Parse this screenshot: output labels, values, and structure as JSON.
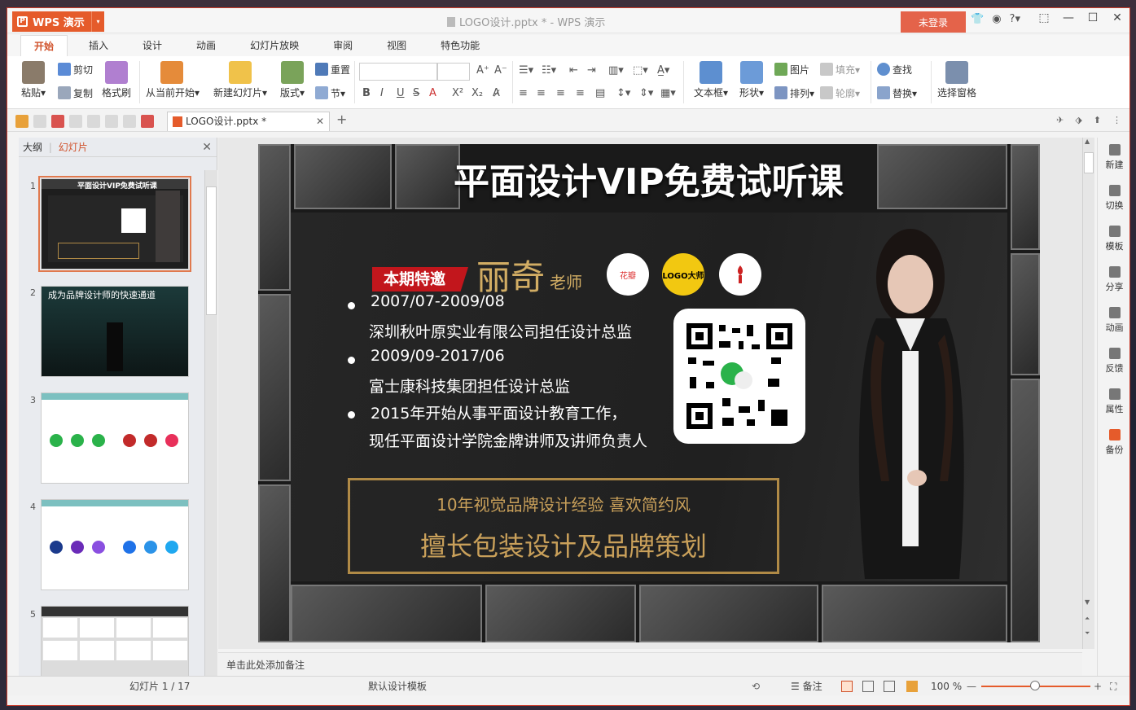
{
  "app": {
    "name": "WPS 演示",
    "window_title": "LOGO设计.pptx * - WPS 演示",
    "login": "未登录",
    "help": "?"
  },
  "tabs": [
    "开始",
    "插入",
    "设计",
    "动画",
    "幻灯片放映",
    "审阅",
    "视图",
    "特色功能"
  ],
  "ribbon": {
    "paste": "粘贴",
    "cut": "剪切",
    "copy": "复制",
    "format_painter": "格式刷",
    "from_current": "从当前开始",
    "new_slide": "新建幻灯片",
    "layout": "版式",
    "reset": "重置",
    "section": "节",
    "textbox": "文本框",
    "shape": "形状",
    "picture": "图片",
    "fill": "填充",
    "arrange": "排列",
    "outline": "轮廓",
    "find": "查找",
    "replace": "替换",
    "select_pane": "选择窗格"
  },
  "doc_tab": {
    "name": "LOGO设计.pptx *"
  },
  "left_panel": {
    "tab_outline": "大纲",
    "tab_slides": "幻灯片",
    "thumbs": [
      {
        "num": "1",
        "title": "平面设计VIP免费试听课"
      },
      {
        "num": "2",
        "title": "成为品牌设计师的快速通道"
      },
      {
        "num": "3",
        "title": ""
      },
      {
        "num": "4",
        "title": ""
      },
      {
        "num": "5",
        "title": ""
      }
    ]
  },
  "slide": {
    "title": "平面设计VIP免费试听课",
    "badge": "本期特邀",
    "teacher": "丽奇",
    "teacher_suffix": "老师",
    "logo1": "花瓣",
    "logo2": "LOGO大师",
    "lines": [
      "2007/07-2009/08",
      "深圳秋叶原实业有限公司担任设计总监",
      "2009/09-2017/06",
      "富士康科技集团担任设计总监",
      "2015年开始从事平面设计教育工作，",
      "现任平面设计学院金牌讲师及讲师负责人"
    ],
    "gold1": "10年视觉品牌设计经验 喜欢简约风",
    "gold2": "擅长包装设计及品牌策划"
  },
  "notes_placeholder": "单击此处添加备注",
  "right_bar": [
    "新建",
    "切换",
    "模板",
    "分享",
    "动画",
    "反馈",
    "属性",
    "备份"
  ],
  "status": {
    "slide_count": "幻灯片 1 / 17",
    "template": "默认设计模板",
    "notes": "备注",
    "zoom": "100 %"
  },
  "colors": {
    "accent": "#e55b2b",
    "gold": "#c9a05a",
    "badge_red": "#c2161c"
  }
}
